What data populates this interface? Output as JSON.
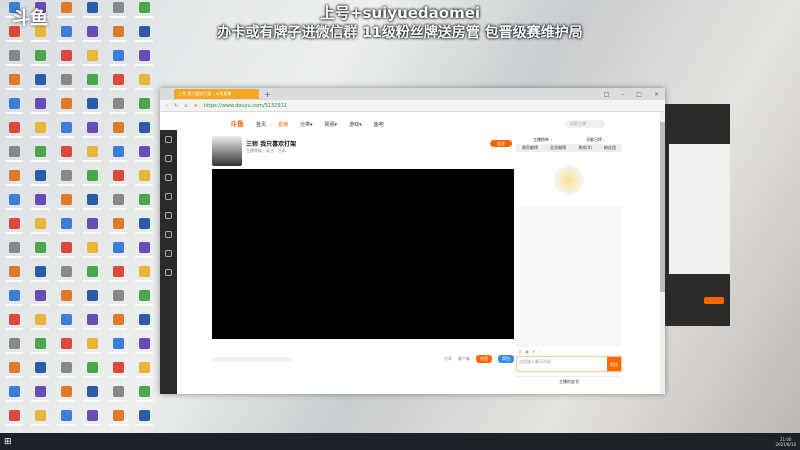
{
  "overlay": {
    "line1": "上号+suiyuedaomei",
    "line2": "办卡或有牌子进微信群 11级粉丝牌送房管 包晋级赛维护局",
    "watermark": "斗鱼"
  },
  "browser": {
    "tab_title": "三师 我只喜欢打架 - 斗鱼直播",
    "url": "https://www.douyu.com/5132911",
    "new_tab": "+",
    "controls": [
      "□",
      "–",
      "□",
      "×"
    ]
  },
  "site": {
    "logo": "斗鱼",
    "nav": [
      "首页",
      "直播",
      "分类▾",
      "视频▾",
      "游戏▾",
      "鱼吧"
    ],
    "search_placeholder": "搜索主播"
  },
  "room": {
    "title": "三师 我只喜欢打架",
    "meta": "主播等级 · 关注 · 分享",
    "follow": "关注",
    "under": [
      "分享",
      "客户端"
    ],
    "under_buttons": [
      "充值",
      "背包"
    ]
  },
  "panel": {
    "ranks": [
      "主播榜单 ›",
      "贡献日榜 ›"
    ],
    "tabs": [
      "周贡献榜",
      "总贡献榜",
      "贵宾(0)",
      "粉丝团"
    ],
    "input_placeholder": "这里输入聊天内容",
    "send": "发送",
    "footer": "主播的友邻"
  },
  "taskbar": {
    "time": "21:00",
    "date": "2021/8/10"
  }
}
